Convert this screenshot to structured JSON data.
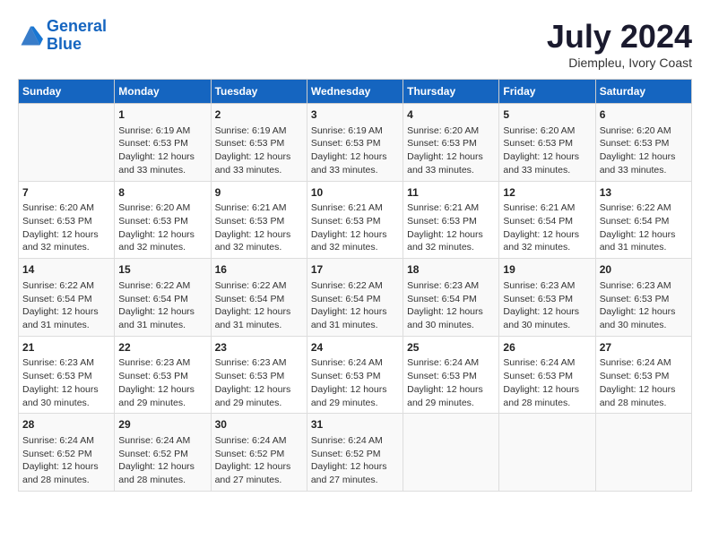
{
  "header": {
    "logo_line1": "General",
    "logo_line2": "Blue",
    "main_title": "July 2024",
    "subtitle": "Diempleu, Ivory Coast"
  },
  "days_of_week": [
    "Sunday",
    "Monday",
    "Tuesday",
    "Wednesday",
    "Thursday",
    "Friday",
    "Saturday"
  ],
  "weeks": [
    [
      {
        "num": "",
        "info": ""
      },
      {
        "num": "1",
        "info": "Sunrise: 6:19 AM\nSunset: 6:53 PM\nDaylight: 12 hours\nand 33 minutes."
      },
      {
        "num": "2",
        "info": "Sunrise: 6:19 AM\nSunset: 6:53 PM\nDaylight: 12 hours\nand 33 minutes."
      },
      {
        "num": "3",
        "info": "Sunrise: 6:19 AM\nSunset: 6:53 PM\nDaylight: 12 hours\nand 33 minutes."
      },
      {
        "num": "4",
        "info": "Sunrise: 6:20 AM\nSunset: 6:53 PM\nDaylight: 12 hours\nand 33 minutes."
      },
      {
        "num": "5",
        "info": "Sunrise: 6:20 AM\nSunset: 6:53 PM\nDaylight: 12 hours\nand 33 minutes."
      },
      {
        "num": "6",
        "info": "Sunrise: 6:20 AM\nSunset: 6:53 PM\nDaylight: 12 hours\nand 33 minutes."
      }
    ],
    [
      {
        "num": "7",
        "info": "Sunrise: 6:20 AM\nSunset: 6:53 PM\nDaylight: 12 hours\nand 32 minutes."
      },
      {
        "num": "8",
        "info": "Sunrise: 6:20 AM\nSunset: 6:53 PM\nDaylight: 12 hours\nand 32 minutes."
      },
      {
        "num": "9",
        "info": "Sunrise: 6:21 AM\nSunset: 6:53 PM\nDaylight: 12 hours\nand 32 minutes."
      },
      {
        "num": "10",
        "info": "Sunrise: 6:21 AM\nSunset: 6:53 PM\nDaylight: 12 hours\nand 32 minutes."
      },
      {
        "num": "11",
        "info": "Sunrise: 6:21 AM\nSunset: 6:53 PM\nDaylight: 12 hours\nand 32 minutes."
      },
      {
        "num": "12",
        "info": "Sunrise: 6:21 AM\nSunset: 6:54 PM\nDaylight: 12 hours\nand 32 minutes."
      },
      {
        "num": "13",
        "info": "Sunrise: 6:22 AM\nSunset: 6:54 PM\nDaylight: 12 hours\nand 31 minutes."
      }
    ],
    [
      {
        "num": "14",
        "info": "Sunrise: 6:22 AM\nSunset: 6:54 PM\nDaylight: 12 hours\nand 31 minutes."
      },
      {
        "num": "15",
        "info": "Sunrise: 6:22 AM\nSunset: 6:54 PM\nDaylight: 12 hours\nand 31 minutes."
      },
      {
        "num": "16",
        "info": "Sunrise: 6:22 AM\nSunset: 6:54 PM\nDaylight: 12 hours\nand 31 minutes."
      },
      {
        "num": "17",
        "info": "Sunrise: 6:22 AM\nSunset: 6:54 PM\nDaylight: 12 hours\nand 31 minutes."
      },
      {
        "num": "18",
        "info": "Sunrise: 6:23 AM\nSunset: 6:54 PM\nDaylight: 12 hours\nand 30 minutes."
      },
      {
        "num": "19",
        "info": "Sunrise: 6:23 AM\nSunset: 6:53 PM\nDaylight: 12 hours\nand 30 minutes."
      },
      {
        "num": "20",
        "info": "Sunrise: 6:23 AM\nSunset: 6:53 PM\nDaylight: 12 hours\nand 30 minutes."
      }
    ],
    [
      {
        "num": "21",
        "info": "Sunrise: 6:23 AM\nSunset: 6:53 PM\nDaylight: 12 hours\nand 30 minutes."
      },
      {
        "num": "22",
        "info": "Sunrise: 6:23 AM\nSunset: 6:53 PM\nDaylight: 12 hours\nand 29 minutes."
      },
      {
        "num": "23",
        "info": "Sunrise: 6:23 AM\nSunset: 6:53 PM\nDaylight: 12 hours\nand 29 minutes."
      },
      {
        "num": "24",
        "info": "Sunrise: 6:24 AM\nSunset: 6:53 PM\nDaylight: 12 hours\nand 29 minutes."
      },
      {
        "num": "25",
        "info": "Sunrise: 6:24 AM\nSunset: 6:53 PM\nDaylight: 12 hours\nand 29 minutes."
      },
      {
        "num": "26",
        "info": "Sunrise: 6:24 AM\nSunset: 6:53 PM\nDaylight: 12 hours\nand 28 minutes."
      },
      {
        "num": "27",
        "info": "Sunrise: 6:24 AM\nSunset: 6:53 PM\nDaylight: 12 hours\nand 28 minutes."
      }
    ],
    [
      {
        "num": "28",
        "info": "Sunrise: 6:24 AM\nSunset: 6:52 PM\nDaylight: 12 hours\nand 28 minutes."
      },
      {
        "num": "29",
        "info": "Sunrise: 6:24 AM\nSunset: 6:52 PM\nDaylight: 12 hours\nand 28 minutes."
      },
      {
        "num": "30",
        "info": "Sunrise: 6:24 AM\nSunset: 6:52 PM\nDaylight: 12 hours\nand 27 minutes."
      },
      {
        "num": "31",
        "info": "Sunrise: 6:24 AM\nSunset: 6:52 PM\nDaylight: 12 hours\nand 27 minutes."
      },
      {
        "num": "",
        "info": ""
      },
      {
        "num": "",
        "info": ""
      },
      {
        "num": "",
        "info": ""
      }
    ]
  ]
}
